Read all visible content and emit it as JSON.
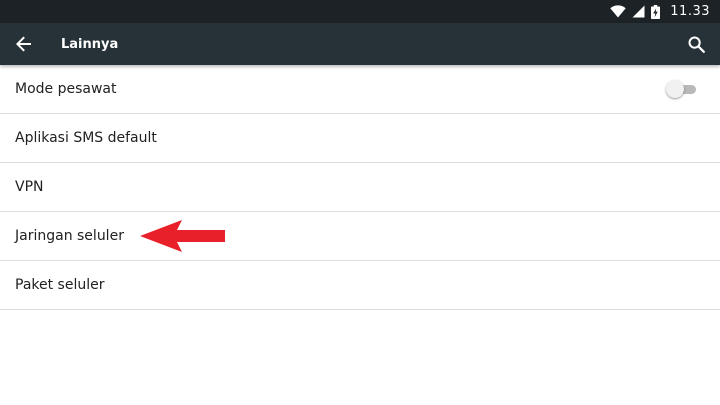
{
  "status_bar": {
    "time": "11.33",
    "icons": [
      "wifi-icon",
      "cell-signal-icon",
      "battery-charging-icon"
    ]
  },
  "app_bar": {
    "title": "Lainnya",
    "back_icon": "arrow-back-icon",
    "search_icon": "search-icon"
  },
  "settings": {
    "items": [
      {
        "label": "Mode pesawat",
        "toggle": "off"
      },
      {
        "label": "Aplikasi SMS default"
      },
      {
        "label": "VPN"
      },
      {
        "label": "Jaringan seluler"
      },
      {
        "label": "Paket seluler"
      }
    ]
  },
  "annotation": {
    "icon": "red-arrow-left-icon",
    "color": "#e8202a"
  },
  "colors": {
    "status_bar": "#1c2226",
    "app_bar": "#263238",
    "divider": "#dedede",
    "text": "#212121"
  }
}
